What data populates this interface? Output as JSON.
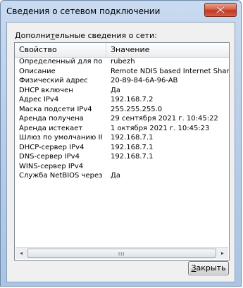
{
  "window": {
    "title": "Сведения о сетевом подключении"
  },
  "group": {
    "label_prefix": "Дополни",
    "label_underlined": "т",
    "label_suffix": "ельные сведения о сети:"
  },
  "table": {
    "columns": [
      "Свойство",
      "Значение"
    ],
    "rows": [
      {
        "property": "Определенный для по...",
        "value": "rubezh"
      },
      {
        "property": "Описание",
        "value": "Remote NDIS based Internet Sharing Dev"
      },
      {
        "property": "Физический адрес",
        "value": "20-89-84-6A-96-AB"
      },
      {
        "property": "DHCP включен",
        "value": "Да"
      },
      {
        "property": "Адрес IPv4",
        "value": "192.168.7.2"
      },
      {
        "property": "Маска подсети IPv4",
        "value": "255.255.255.0"
      },
      {
        "property": "Аренда получена",
        "value": "29 сентября 2021 г. 10:45:22"
      },
      {
        "property": "Аренда истекает",
        "value": "1 октября 2021 г. 10:45:23"
      },
      {
        "property": "Шлюз по умолчанию IP...",
        "value": "192.168.7.1"
      },
      {
        "property": "DHCP-сервер IPv4",
        "value": "192.168.7.1"
      },
      {
        "property": "DNS-сервер IPv4",
        "value": "192.168.7.1"
      },
      {
        "property": "WINS-сервер IPv4",
        "value": ""
      },
      {
        "property": "Служба NetBIOS через...",
        "value": "Да"
      }
    ]
  },
  "scrollbar": {
    "left_arrow": "◂",
    "right_arrow": "▸",
    "grip": "III"
  },
  "buttons": {
    "close_mnemonic": "З",
    "close_rest": "акрыть"
  },
  "colors": {
    "close_button_red": "#c2371d",
    "frame_blue": "#aac4e6"
  }
}
